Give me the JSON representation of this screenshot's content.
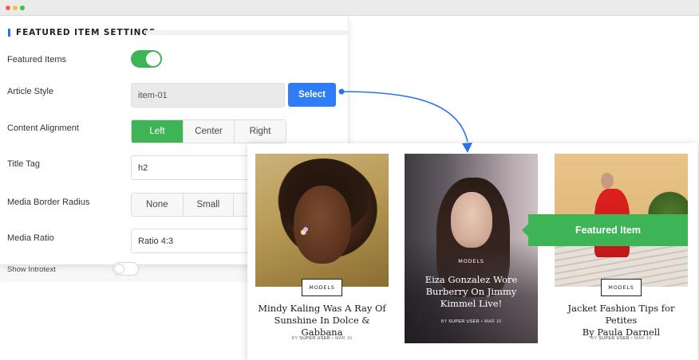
{
  "settings": {
    "section_title": "FEATURED ITEM SETTINGS",
    "featured_items_label": "Featured Items",
    "featured_items_on": true,
    "article_style_label": "Article Style",
    "article_style_value": "item-01",
    "select_button": "Select",
    "content_alignment_label": "Content Alignment",
    "alignment_options": [
      "Left",
      "Center",
      "Right"
    ],
    "alignment_selected": "Left",
    "title_tag_label": "Title Tag",
    "title_tag_value": "h2",
    "media_border_radius_label": "Media Border Radius",
    "radius_options": [
      "None",
      "Small"
    ],
    "media_ratio_label": "Media Ratio",
    "media_ratio_value": "Ratio 4:3",
    "show_introtext_label": "Show Introtext",
    "show_introtext_on": false
  },
  "preview": {
    "featured_badge": "Featured Item",
    "cards": [
      {
        "category": "MODELS",
        "title_line1": "Mindy Kaling Was A Ray Of",
        "title_line2": "Sunshine In Dolce & Gabbana",
        "meta_by": "BY",
        "meta_author": "SUPER USER",
        "meta_date": "MAR 16"
      },
      {
        "category": "MODELS",
        "title_line1": "Eiza Gonzalez Wore",
        "title_line2": "Burberry On Jimmy",
        "title_line3": "Kimmel Live!",
        "meta_by": "BY",
        "meta_author": "SUPER USER",
        "meta_date": "MAR 16"
      },
      {
        "category": "MODELS",
        "title_line1": "Jacket Fashion Tips for Petites",
        "title_line2": "By Paula Darnell",
        "meta_by": "BY",
        "meta_author": "SUPER USER",
        "meta_date": "MAR 16"
      }
    ]
  },
  "colors": {
    "accent_green": "#3db556",
    "accent_blue": "#2e7cf6"
  }
}
